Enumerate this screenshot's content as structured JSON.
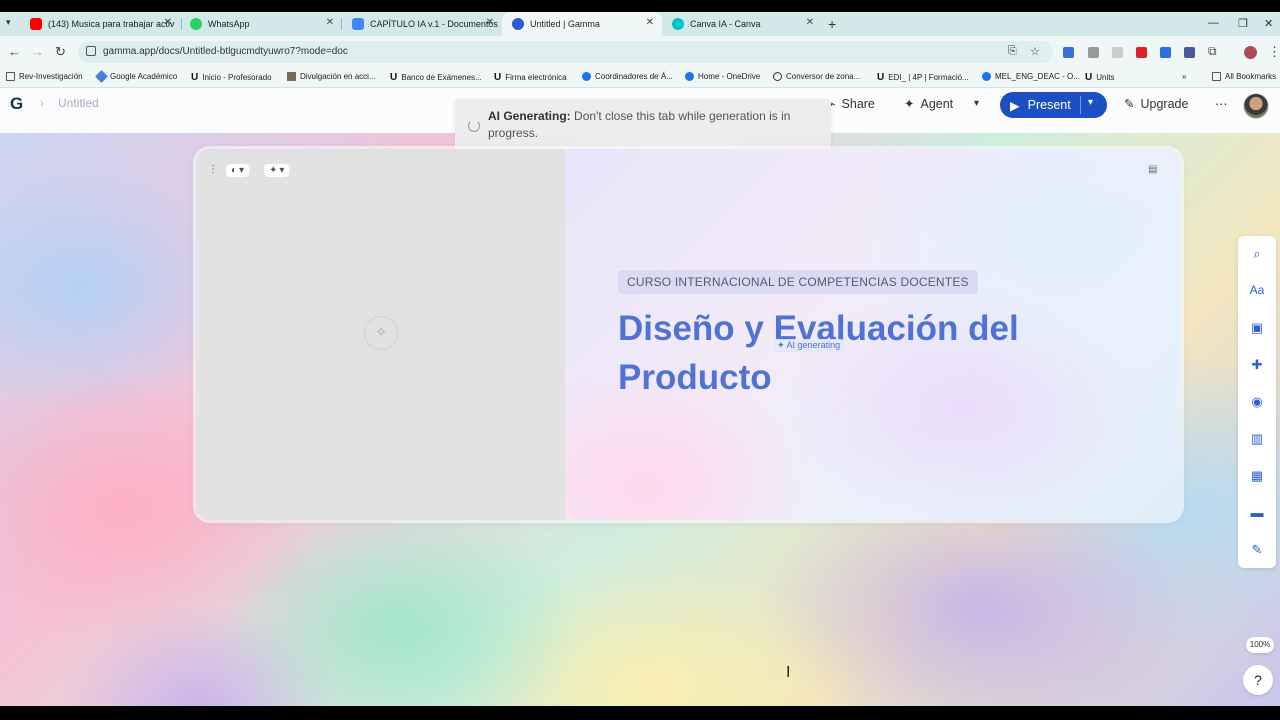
{
  "browser": {
    "tabs": [
      {
        "title": "(143) Musica para trabajar activ",
        "favicon_color": "#ff0000"
      },
      {
        "title": "WhatsApp",
        "favicon_color": "#25d366"
      },
      {
        "title": "CAPÍTULO IA v.1 - Documentos",
        "favicon_color": "#4285f4"
      },
      {
        "title": "Untitled | Gamma",
        "favicon_color": "#2d5bd6"
      },
      {
        "title": "Canva IA - Canva",
        "favicon_color": "#00c4cc"
      }
    ],
    "active_tab": "Untitled | Gamma",
    "url": "gamma.app/docs/Untitled-btlgucmdtyuwro7?mode=doc",
    "bookmarks": [
      {
        "label": "Rev-Investigación",
        "icon": "folder-icon"
      },
      {
        "label": "Google Académico",
        "icon": "scholar-icon"
      },
      {
        "label": "Inicio - Profesorado",
        "icon": "u-logo-icon"
      },
      {
        "label": "Divulgación en acci...",
        "icon": "image-icon"
      },
      {
        "label": "Banco de Exámenes...",
        "icon": "u-logo-icon"
      },
      {
        "label": "Firma electrónica",
        "icon": "u-logo-icon"
      },
      {
        "label": "Coordinadores de Á...",
        "icon": "onedrive-icon"
      },
      {
        "label": "Home - OneDrive",
        "icon": "onedrive-icon"
      },
      {
        "label": "Conversor de zona...",
        "icon": "clock-icon"
      },
      {
        "label": "EDI_ | 4P | Formació...",
        "icon": "u-logo-icon"
      },
      {
        "label": "MEL_ENG_DEAC - O...",
        "icon": "onedrive-icon"
      },
      {
        "label": "Units",
        "icon": "u-logo-icon"
      }
    ],
    "all_bookmarks": "All Bookmarks"
  },
  "app": {
    "doc_title": "Untitled",
    "logo": "G",
    "header": {
      "share": "Share",
      "agent": "Agent",
      "present": "Present",
      "upgrade": "Upgrade"
    },
    "toast": {
      "bold": "AI Generating:",
      "text": " Don't close this tab while generation is in progress."
    },
    "card": {
      "subtitle": "CURSO INTERNACIONAL DE COMPETENCIAS DOCENTES",
      "title": "Diseño y Evaluación del Producto",
      "ai_badge": "✦ AI generating"
    },
    "zoom": "100%",
    "help": "?"
  },
  "colors": {
    "accent": "#1c4fc2",
    "title": "#4f72d3"
  }
}
